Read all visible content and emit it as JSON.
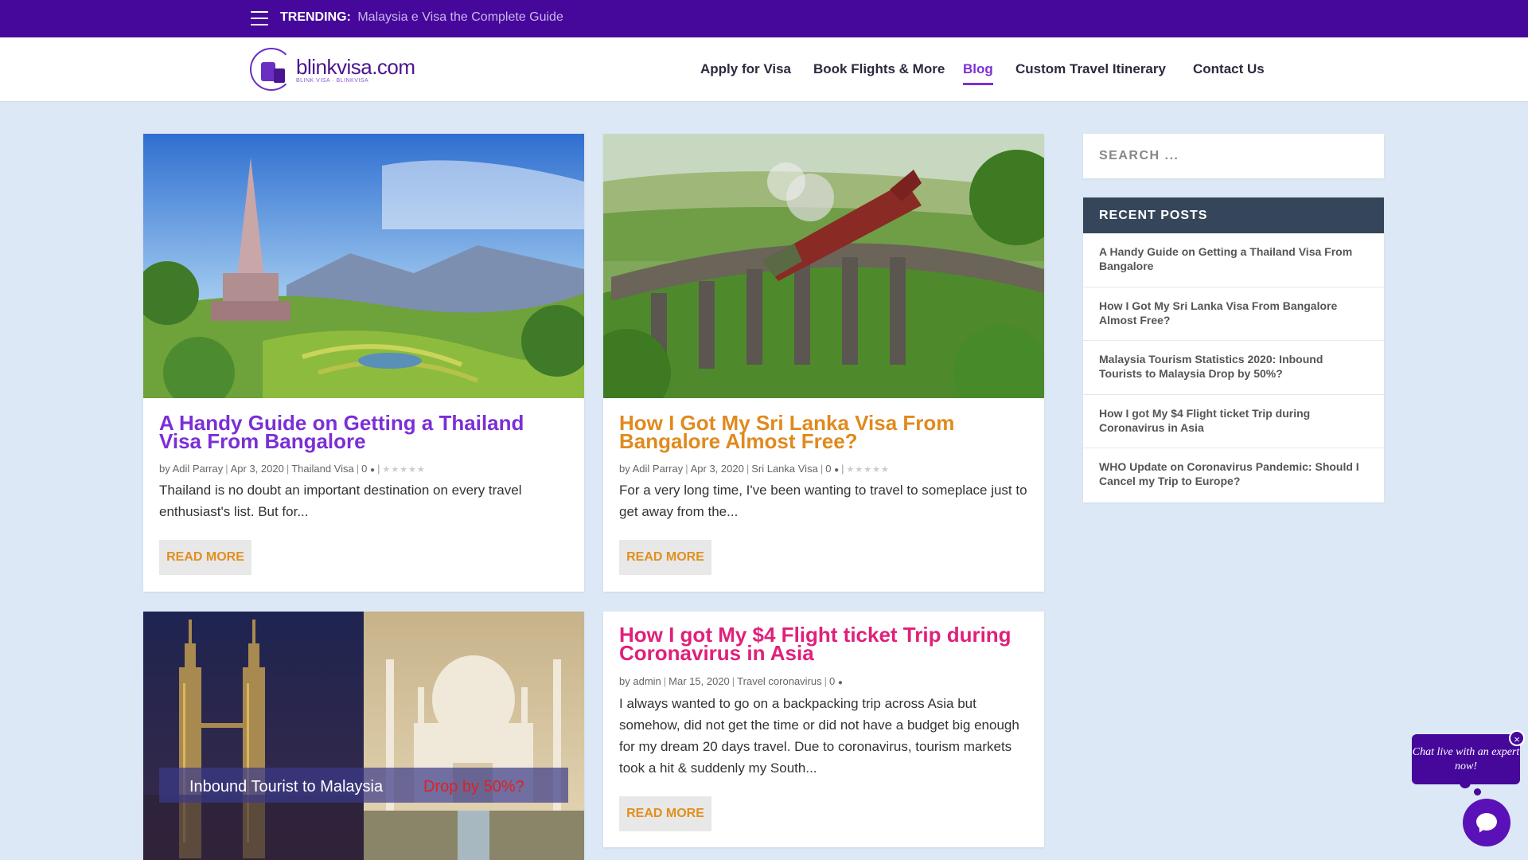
{
  "topbar": {
    "trending_label": "TRENDING:",
    "trending_link": "Malaysia e Visa the Complete Guide"
  },
  "logo": {
    "name": "blinkvisa.com",
    "tagline": "BLINK VISA · BLINKVISA"
  },
  "nav": {
    "items": [
      {
        "label": "Apply for Visa"
      },
      {
        "label": "Book Flights & More"
      },
      {
        "label": "Blog",
        "active": true
      },
      {
        "label": "Custom Travel Itinerary"
      },
      {
        "label": "Contact Us"
      }
    ]
  },
  "posts": [
    {
      "title": "A Handy Guide on Getting a Thailand Visa From Bangalore",
      "title_color": "#7b2fd6",
      "author": "Adil Parray",
      "date": "Apr 3, 2020",
      "category": "Thailand Visa",
      "comments": "0",
      "excerpt": "Thailand is no doubt an important destination on every travel enthusiast's list. But for...",
      "read_more": "READ MORE"
    },
    {
      "title": "How I Got My Sri Lanka Visa From Bangalore Almost Free?",
      "title_color": "#e08a1e",
      "author": "Adil Parray",
      "date": "Apr 3, 2020",
      "category": "Sri Lanka Visa",
      "comments": "0",
      "excerpt": "For a very long time, I've been wanting to travel to someplace just to get away from the...",
      "read_more": "READ MORE"
    },
    {
      "image_caption_white": "Inbound Tourist to Malaysia",
      "image_caption_red": "Drop by 50%?"
    },
    {
      "title": "How I got My $4 Flight ticket Trip during Coronavirus in Asia",
      "title_color": "#e0207a",
      "author": "admin",
      "date": "Mar 15, 2020",
      "category": "Travel coronavirus",
      "comments": "0",
      "excerpt": "I always wanted to go on a backpacking trip across Asia but somehow, did not get the time or did not have a budget big enough for my dream 20 days travel. Due to coronavirus, tourism markets took a hit & suddenly my South...",
      "read_more": "READ MORE"
    }
  ],
  "meta_labels": {
    "by": "by",
    "sep": "|"
  },
  "sidebar": {
    "search_placeholder": "SEARCH ...",
    "recent_title": "RECENT POSTS",
    "recent_items": [
      "A Handy Guide on Getting a Thailand Visa From Bangalore",
      "How I Got My Sri Lanka Visa From Bangalore Almost Free?",
      "Malaysia Tourism Statistics 2020: Inbound Tourists to Malaysia Drop by 50%?",
      "How I got My $4 Flight ticket Trip during Coronavirus in Asia",
      "WHO Update on Coronavirus Pandemic: Should I Cancel my Trip to Europe?"
    ]
  },
  "chat": {
    "popup_text": "Chat live with an expert now!",
    "close": "×"
  },
  "colors": {
    "brand_purple": "#45089a",
    "accent_purple": "#7b2fd6",
    "accent_orange": "#e08a1e",
    "accent_pink": "#e0207a",
    "page_bg": "#dce8f6"
  }
}
